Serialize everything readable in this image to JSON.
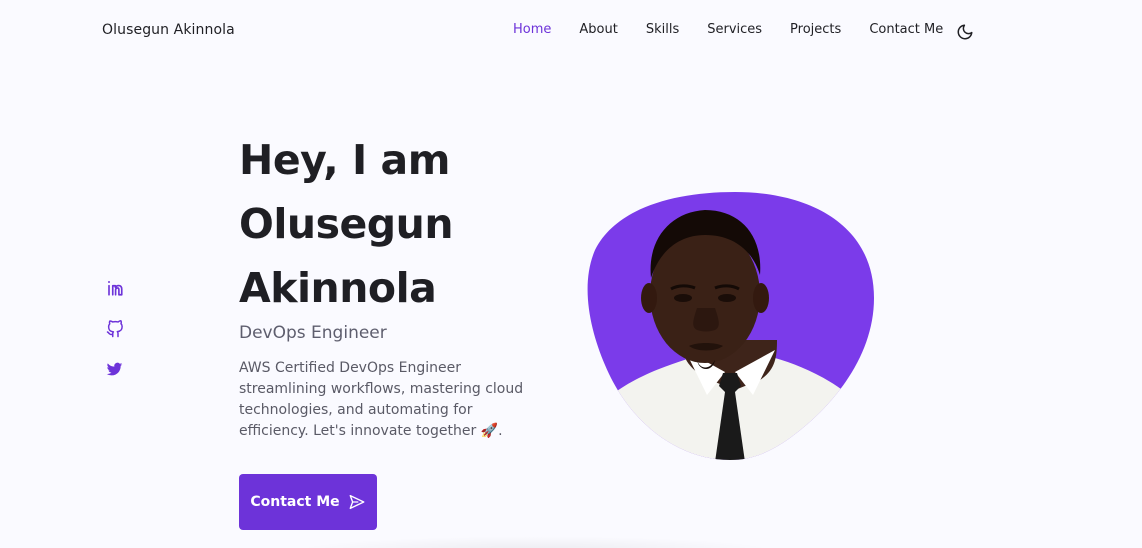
{
  "header": {
    "brand": "Olusegun Akinnola",
    "nav": [
      {
        "label": "Home",
        "active": true
      },
      {
        "label": "About",
        "active": false
      },
      {
        "label": "Skills",
        "active": false
      },
      {
        "label": "Services",
        "active": false
      },
      {
        "label": "Projects",
        "active": false
      },
      {
        "label": "Contact Me",
        "active": false
      }
    ],
    "theme_toggle_icon": "moon-icon"
  },
  "social": [
    {
      "name": "linkedin",
      "icon": "linkedin-icon"
    },
    {
      "name": "github",
      "icon": "github-icon"
    },
    {
      "name": "twitter",
      "icon": "twitter-icon"
    }
  ],
  "hero": {
    "title_lines": [
      "Hey, I am",
      "Olusegun",
      "Akinnola"
    ],
    "role": "DevOps Engineer",
    "description": "AWS Certified DevOps Engineer streamlining workflows, mastering cloud technologies, and automating for efficiency. Let's innovate together 🚀.",
    "cta_label": "Contact Me",
    "cta_icon": "send-icon"
  },
  "colors": {
    "accent": "#6d33d9",
    "background": "#fafaff",
    "heading": "#1f1f24",
    "muted": "#5a5a66"
  }
}
